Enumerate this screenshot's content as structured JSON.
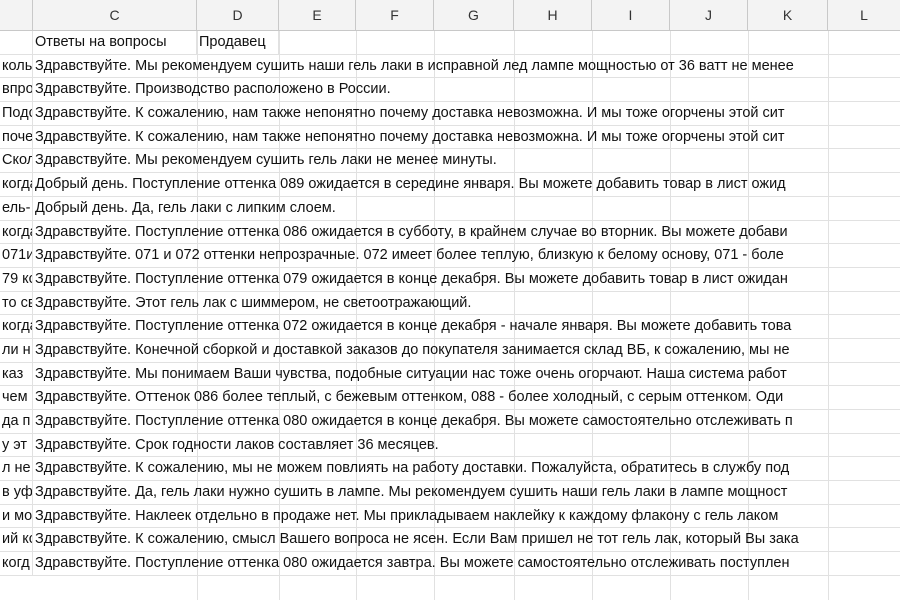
{
  "columns": [
    "C",
    "D",
    "E",
    "F",
    "G",
    "H",
    "I",
    "J",
    "K",
    "L"
  ],
  "header_row": {
    "b": "",
    "c": "Ответы на вопросы",
    "d": "Продавец"
  },
  "rows": [
    {
      "b": "коль",
      "c": "Здравствуйте. Мы рекомендуем сушить наши гель лаки в исправной лед лампе мощностью от 36 ватт не менее"
    },
    {
      "b": "впро",
      "c": "Здравствуйте. Производство расположено в России."
    },
    {
      "b": "Подс",
      "c": "Здравствуйте. К сожалению, нам также непонятно почему доставка невозможна. И мы тоже огорчены этой сит"
    },
    {
      "b": "поче",
      "c": "Здравствуйте. К сожалению, нам также непонятно почему доставка невозможна. И мы тоже огорчены этой сит"
    },
    {
      "b": "Скол",
      "c": "Здравствуйте. Мы рекомендуем сушить гель лаки не менее минуты."
    },
    {
      "b": "когда",
      "c": "Добрый день. Поступление оттенка 089 ожидается в середине января. Вы можете добавить товар в лист ожид"
    },
    {
      "b": "ель-",
      "c": "Добрый день. Да, гель лаки с липким слоем."
    },
    {
      "b": "когда",
      "c": "Здравствуйте. Поступление оттенка 086 ожидается в субботу, в крайнем случае во вторник. Вы можете добави"
    },
    {
      "b": "071и",
      "c": "Здравствуйте. 071 и 072 оттенки непрозрачные. 072 имеет более теплую, близкую к белому основу, 071 - боле"
    },
    {
      "b": "79 кс",
      "c": "Здравствуйте. Поступление оттенка 079 ожидается в конце декабря. Вы можете добавить товар в лист ожидан"
    },
    {
      "b": "то св",
      "c": "Здравствуйте. Этот гель лак с шиммером, не светоотражающий."
    },
    {
      "b": "когда",
      "c": "Здравствуйте. Поступление оттенка 072 ожидается в конце декабря - начале января. Вы можете добавить това"
    },
    {
      "b": "ли н",
      "c": "Здравствуйте. Конечной сборкой и доставкой заказов до покупателя занимается склад ВБ, к сожалению, мы не"
    },
    {
      "b": "каз",
      "c": "Здравствуйте. Мы понимаем Ваши чувства, подобные ситуации  нас тоже очень огорчают. Наша система работ"
    },
    {
      "b": "чем",
      "c": "Здравствуйте. Оттенок 086 более теплый, с бежевым оттенком, 088 - более холодный, с серым оттенком. Оди"
    },
    {
      "b": "да п",
      "c": "Здравствуйте. Поступление оттенка 080 ожидается в конце декабря. Вы можете самостоятельно отслеживать п"
    },
    {
      "b": "у эт",
      "c": "Здравствуйте. Срок годности лаков составляет 36 месяцев."
    },
    {
      "b": "л не",
      "c": "Здравствуйте. К сожалению, мы не можем повлиять на работу доставки. Пожалуйста, обратитесь в службу под"
    },
    {
      "b": "в уф",
      "c": "Здравствуйте. Да, гель лаки нужно сушить в лампе. Мы рекомендуем сушить наши гель лаки в лампе мощност"
    },
    {
      "b": "и мо:",
      "c": "Здравствуйте. Наклеек отдельно в продаже нет. Мы прикладываем наклейку к каждому флакону с гель лаком"
    },
    {
      "b": "ий кс",
      "c": "Здравствуйте. К сожалению, смысл Вашего вопроса не ясен. Если Вам пришел не тот гель лак, который Вы зака"
    },
    {
      "b": "когд",
      "c": "Здравствуйте. Поступление оттенка 080 ожидается завтра. Вы можете самостоятельно отслеживать поступлен"
    }
  ]
}
